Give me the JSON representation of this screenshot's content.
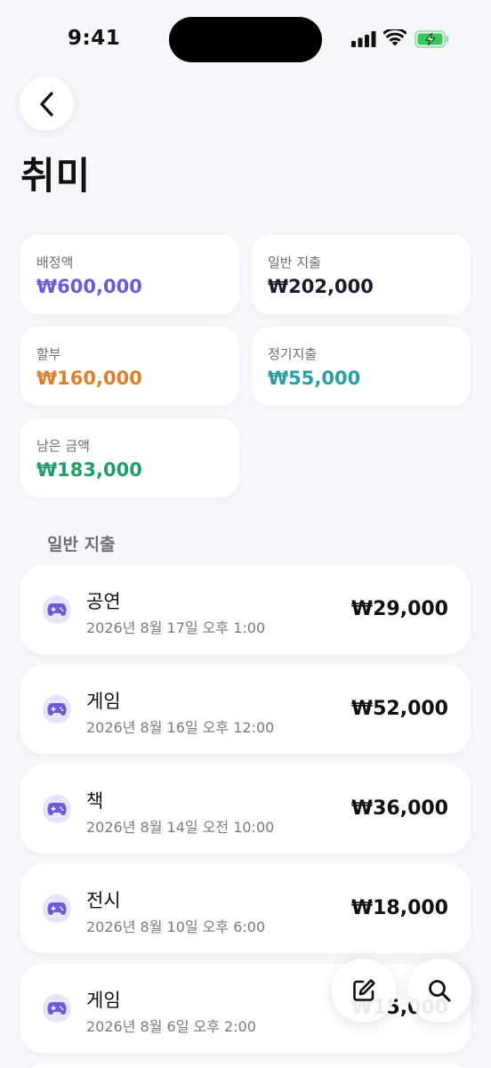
{
  "status_bar": {
    "time": "9:41"
  },
  "header": {
    "title": "취미"
  },
  "summary": {
    "allocated": {
      "label": "배정액",
      "value": "₩600,000",
      "color": "#6b5bd6"
    },
    "general": {
      "label": "일반 지출",
      "value": "₩202,000",
      "color": "#1c1b2e"
    },
    "installment": {
      "label": "할부",
      "value": "₩160,000",
      "color": "#e07f2b"
    },
    "recurring": {
      "label": "정기지출",
      "value": "₩55,000",
      "color": "#2a9fa3"
    },
    "remaining": {
      "label": "남은 금액",
      "value": "₩183,000",
      "color": "#1f9e6a"
    }
  },
  "section": {
    "title": "일반 지출"
  },
  "transactions": [
    {
      "name": "공연",
      "date": "2026년 8월 17일 오후 1:00",
      "amount": "₩29,000",
      "icon": "gamepad-icon"
    },
    {
      "name": "게임",
      "date": "2026년 8월 16일 오후 12:00",
      "amount": "₩52,000",
      "icon": "gamepad-icon"
    },
    {
      "name": "책",
      "date": "2026년 8월 14일 오전 10:00",
      "amount": "₩36,000",
      "icon": "gamepad-icon"
    },
    {
      "name": "전시",
      "date": "2026년 8월 10일 오후 6:00",
      "amount": "₩18,000",
      "icon": "gamepad-icon"
    },
    {
      "name": "게임",
      "date": "2026년 8월 6일 오후 2:00",
      "amount": "₩15,000",
      "icon": "gamepad-icon"
    }
  ],
  "actions": {
    "edit_icon": "edit-icon",
    "search_icon": "search-icon"
  },
  "colors": {
    "accent": "#6b5bd6",
    "icon_bg": "#e8e4fb",
    "battery": "#34c759"
  }
}
